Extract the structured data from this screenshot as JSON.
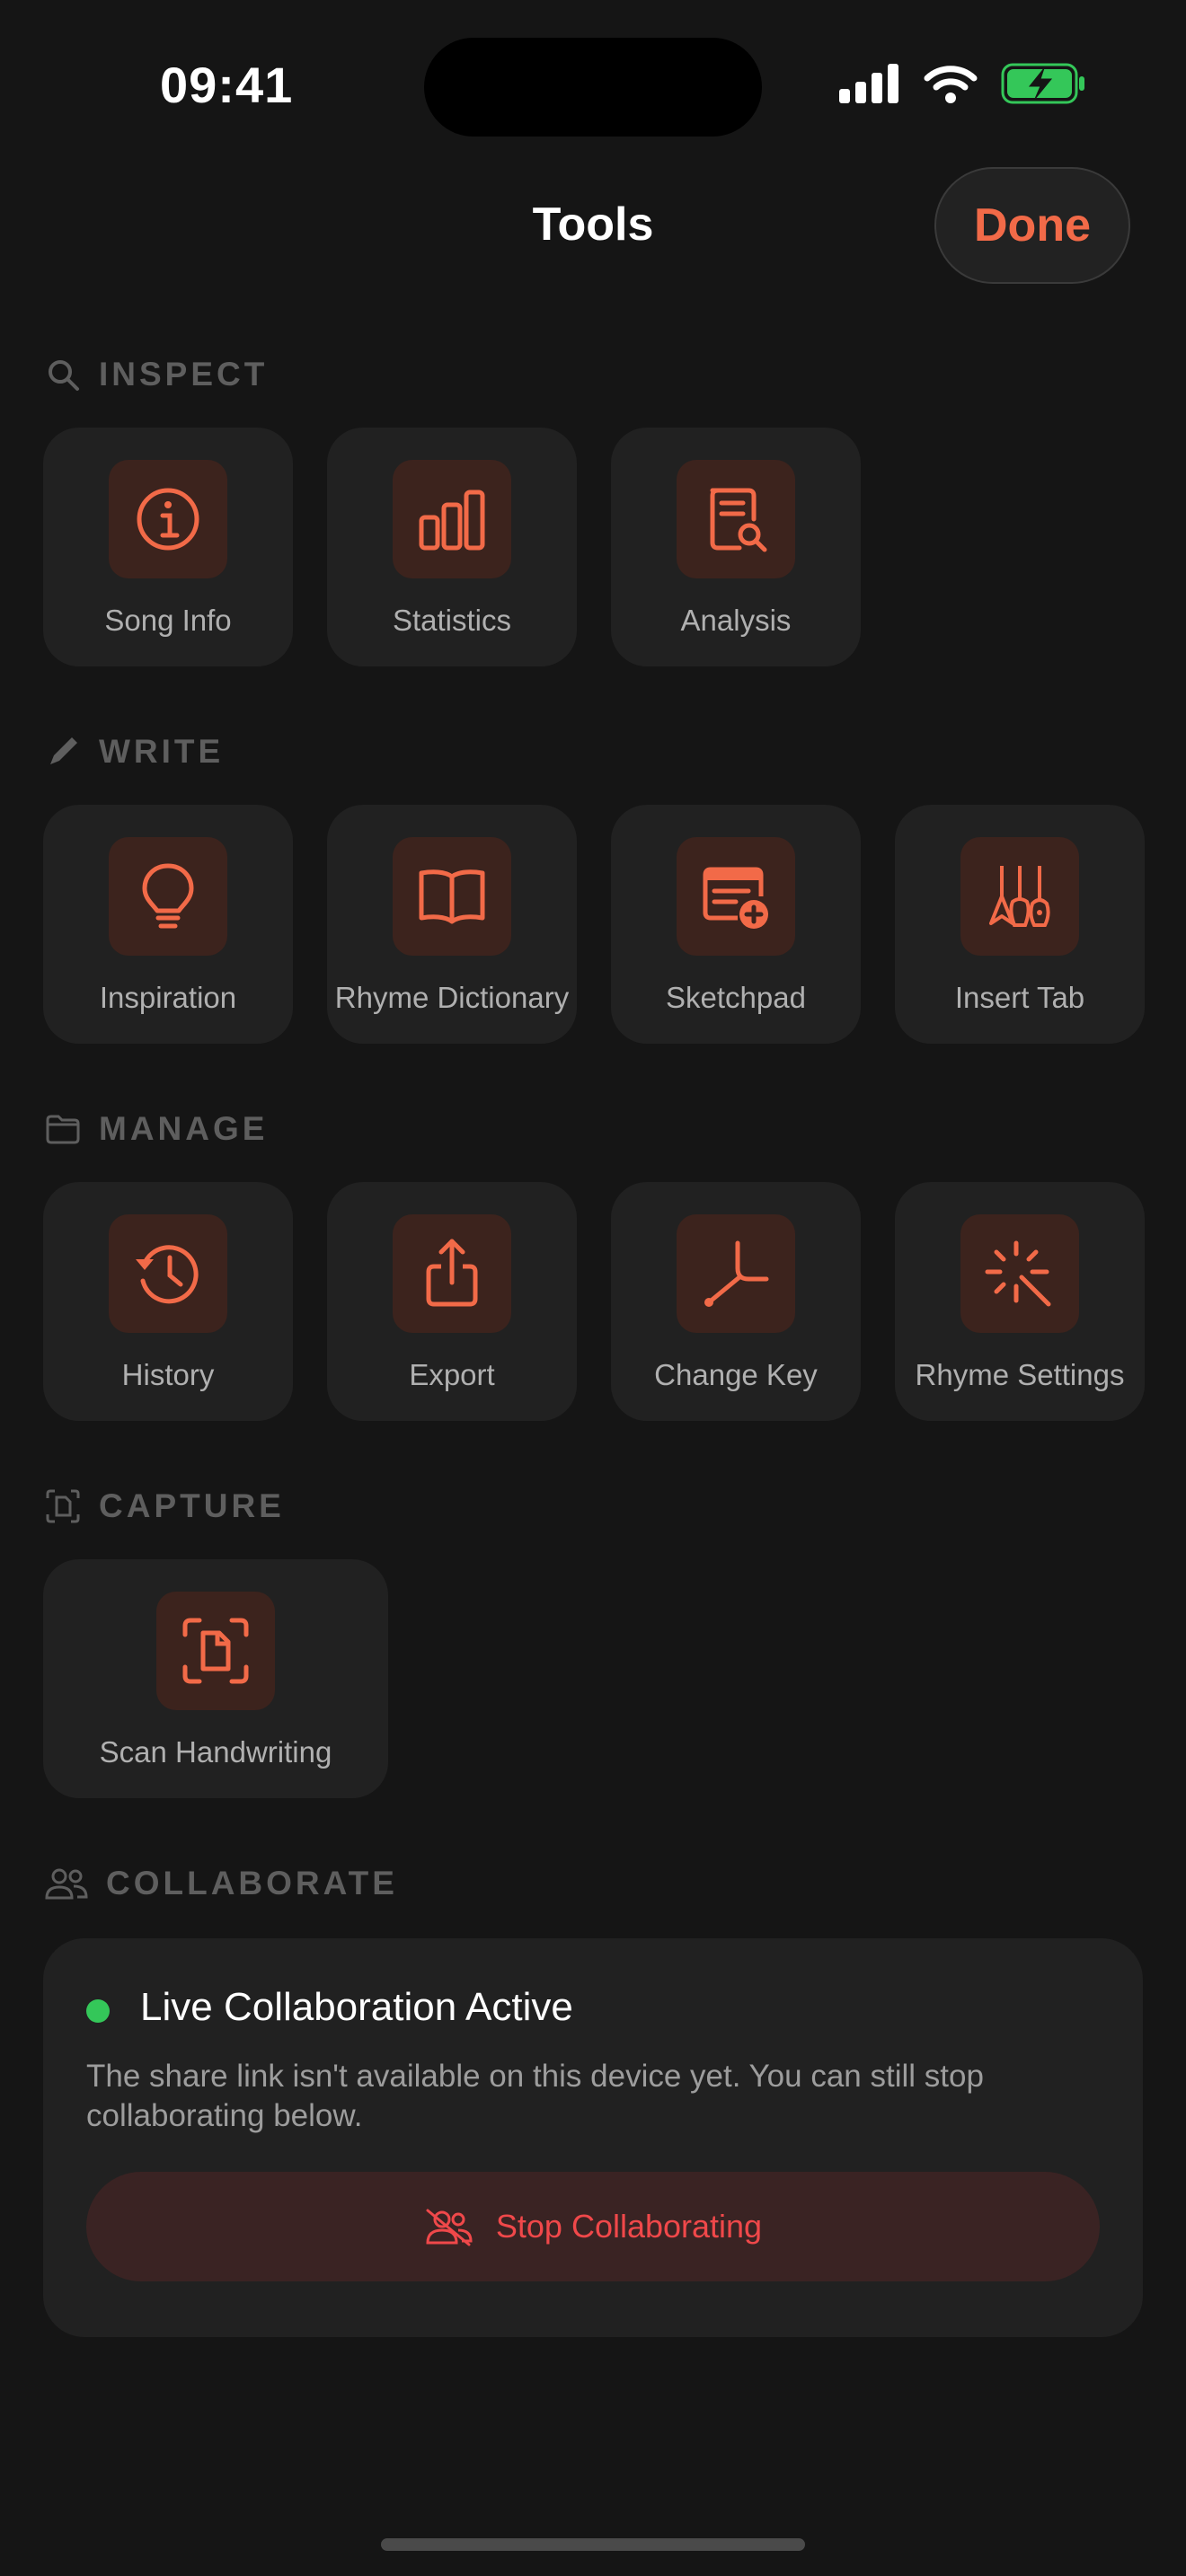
{
  "status_bar": {
    "time": "09:41"
  },
  "nav": {
    "title": "Tools",
    "done_label": "Done"
  },
  "colors": {
    "accent": "#f26a48",
    "tile_bg": "#212121",
    "badge_bg": "#3c231d",
    "live_green": "#34c759",
    "danger": "#f0484a"
  },
  "sections": {
    "inspect": {
      "title": "INSPECT",
      "icon": "search-icon",
      "items": [
        {
          "label": "Song Info",
          "icon": "info-circle-icon"
        },
        {
          "label": "Statistics",
          "icon": "bar-chart-icon"
        },
        {
          "label": "Analysis",
          "icon": "document-search-icon"
        }
      ]
    },
    "write": {
      "title": "WRITE",
      "icon": "pencil-icon",
      "items": [
        {
          "label": "Inspiration",
          "icon": "lightbulb-icon"
        },
        {
          "label": "Rhyme Dictionary",
          "icon": "book-icon"
        },
        {
          "label": "Sketchpad",
          "icon": "sketchpad-add-icon"
        },
        {
          "label": "Insert Tab",
          "icon": "guitars-icon"
        }
      ]
    },
    "manage": {
      "title": "MANAGE",
      "icon": "folder-icon",
      "items": [
        {
          "label": "History",
          "icon": "history-icon"
        },
        {
          "label": "Export",
          "icon": "share-icon"
        },
        {
          "label": "Change Key",
          "icon": "tuning-fork-icon"
        },
        {
          "label": "Rhyme Settings",
          "icon": "sparkle-wand-icon"
        }
      ]
    },
    "capture": {
      "title": "CAPTURE",
      "icon": "scan-document-icon",
      "items": [
        {
          "label": "Scan Handwriting",
          "icon": "scan-document-icon"
        }
      ]
    },
    "collaborate": {
      "title": "COLLABORATE",
      "icon": "people-icon",
      "status_title": "Live Collaboration Active",
      "description": "The share link isn't available on this device yet. You can still stop collaborating below.",
      "stop_label": "Stop Collaborating"
    }
  }
}
